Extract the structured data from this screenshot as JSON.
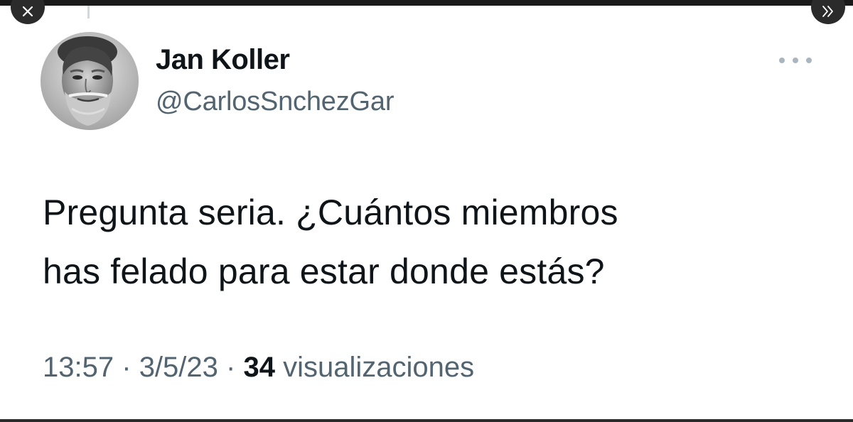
{
  "tweet": {
    "author_name": "Jan Koller",
    "author_handle": "@CarlosSnchezGar",
    "text_line1": "Pregunta seria. ¿Cuántos miembros",
    "text_line2": "has felado para estar donde estás?",
    "time": "13:57",
    "date": "3/5/23",
    "separator": "·",
    "views_count": "34",
    "views_label": "visualizaciones"
  },
  "icons": {
    "close": "close-icon",
    "next": "double-chevron-right-icon",
    "more": "more-horizontal-icon",
    "avatar": "avatar-photo"
  },
  "colors": {
    "name_text": "#0f1419",
    "secondary_text": "#536471",
    "overlay_button": "#2b2b2b",
    "thread_line": "#cfd9de"
  }
}
